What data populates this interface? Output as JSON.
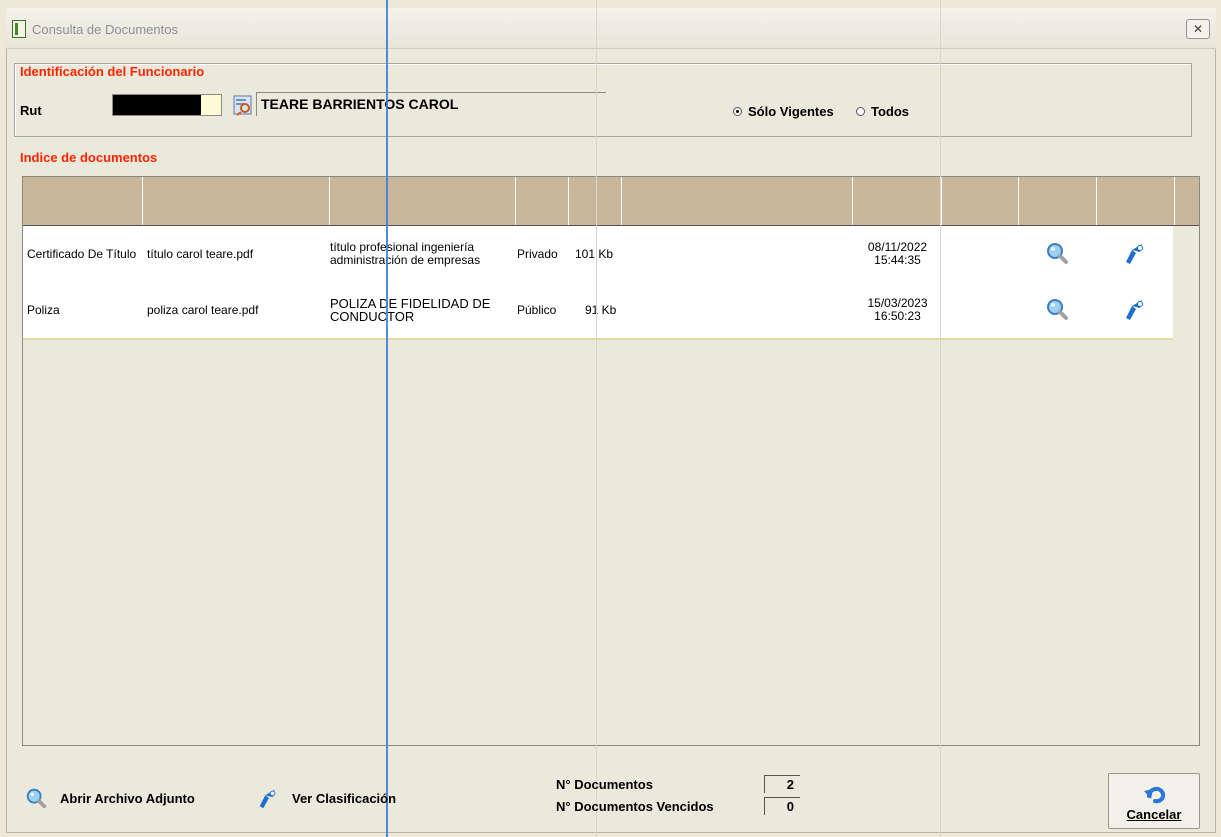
{
  "window": {
    "title": "Consulta de Documentos",
    "close_glyph": "✕"
  },
  "funcionario": {
    "section_title": "Identificación del Funcionario",
    "rut_label": "Rut",
    "name": "TEARE BARRIENTOS CAROL",
    "filter_options": [
      {
        "label": "Sólo Vigentes",
        "selected": true
      },
      {
        "label": "Todos",
        "selected": false
      }
    ]
  },
  "documentos": {
    "section_title": "Indice de documentos",
    "rows": [
      {
        "tipo": "Certificado De Título",
        "archivo": "título carol teare.pdf",
        "descripcion": "título profesional ingeniería administración de empresas",
        "acceso": "Privado",
        "tamano": "101 Kb",
        "fecha": "08/11/2022",
        "hora": "15:44:35"
      },
      {
        "tipo": "Poliza",
        "archivo": "poliza carol teare.pdf",
        "descripcion": "POLIZA DE FIDELIDAD DE CONDUCTOR",
        "acceso": "Público",
        "tamano": "91 Kb",
        "fecha": "15/03/2023",
        "hora": "16:50:23"
      }
    ]
  },
  "footer": {
    "legend_open": "Abrir Archivo Adjunto",
    "legend_classify": "Ver Clasificación",
    "n_documentos_label": "N° Documentos",
    "n_documentos": "2",
    "n_vencidos_label": "N° Documentos Vencidos",
    "n_vencidos": "0",
    "cancel_label": "Cancelar"
  },
  "colors": {
    "section_title": "#ff2400",
    "header_bg": "#c8b79a",
    "accent_line": "#3f7fd9"
  }
}
